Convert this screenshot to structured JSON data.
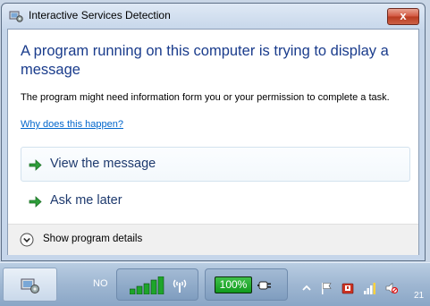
{
  "window": {
    "title": "Interactive Services Detection",
    "close_label": "x"
  },
  "dialog": {
    "heading": "A program running on this computer is trying to display a message",
    "body": "The program might need information form you or your permission to complete a task.",
    "link": "Why does this happen?",
    "commands": [
      {
        "label": "View the message",
        "icon": "green-arrow-icon"
      },
      {
        "label": "Ask me later",
        "icon": "green-arrow-icon"
      }
    ],
    "details_toggle": "Show program details"
  },
  "taskbar": {
    "network_label": "NO",
    "signal_bars": 5,
    "battery_level": "100%",
    "clock": "21"
  },
  "colors": {
    "heading": "#1a3c8c",
    "link": "#0066cc",
    "arrow": "#2e9e3a",
    "battery": "#1ca62a"
  }
}
